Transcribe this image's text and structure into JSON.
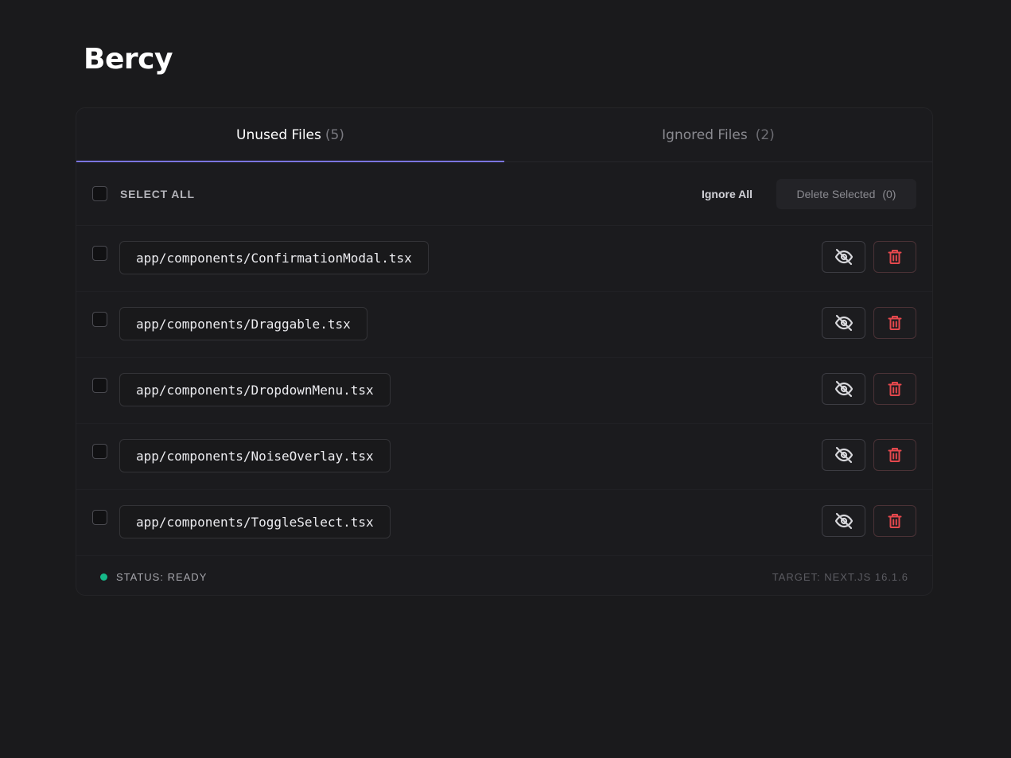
{
  "app": {
    "title": "Bercy"
  },
  "tabs": [
    {
      "label": "Unused Files",
      "count": "(5)"
    },
    {
      "label": "Ignored Files",
      "count": "(2)"
    }
  ],
  "toolbar": {
    "select_all_label": "SELECT ALL",
    "ignore_all_label": "Ignore All",
    "delete_selected_label": "Delete Selected",
    "delete_selected_count": "(0)"
  },
  "files": [
    {
      "path": "app/components/ConfirmationModal.tsx",
      "checked": false
    },
    {
      "path": "app/components/Draggable.tsx",
      "checked": false
    },
    {
      "path": "app/components/DropdownMenu.tsx",
      "checked": false
    },
    {
      "path": "app/components/NoiseOverlay.tsx",
      "checked": false
    },
    {
      "path": "app/components/ToggleSelect.tsx",
      "checked": false
    }
  ],
  "row_actions": {
    "ignore_icon": "eye-off-icon",
    "delete_icon": "trash-icon"
  },
  "status": {
    "text": "STATUS: READY",
    "dot_color": "#16b989"
  },
  "footer": {
    "target": "TARGET: NEXT.JS 16.1.6"
  },
  "colors": {
    "accent": "#7b75e0",
    "danger": "#e5484d",
    "background": "#1a1a1c"
  }
}
